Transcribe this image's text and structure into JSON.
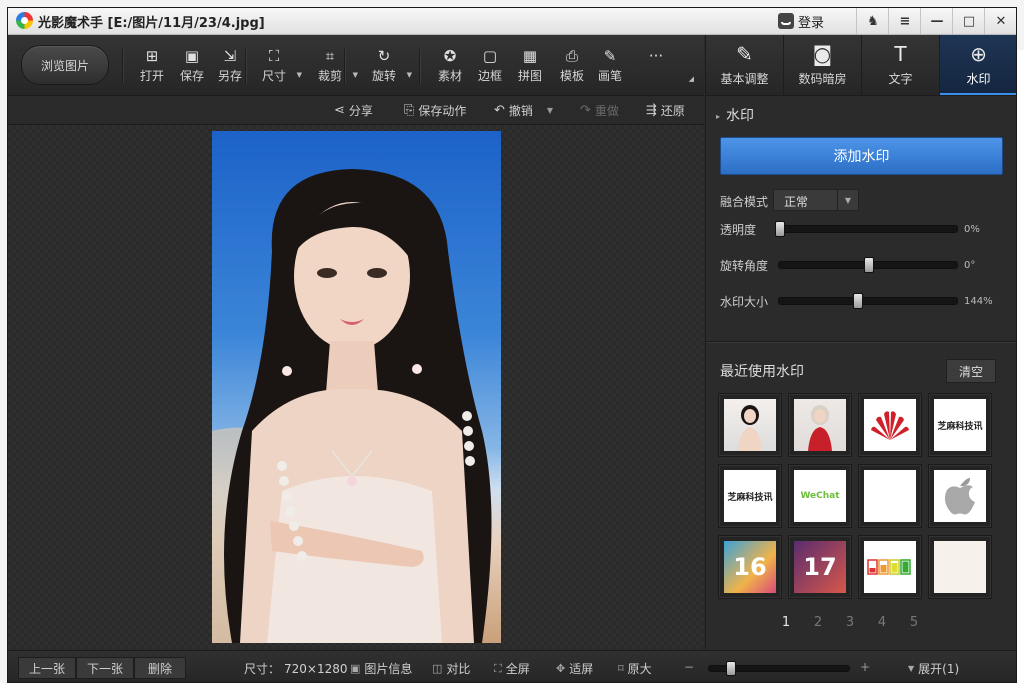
{
  "window": {
    "title": "光影魔术手 [E:/图片/11月/23/4.jpg]",
    "login": "登录"
  },
  "toolbar": {
    "browse": "浏览图片",
    "tools": [
      {
        "label": "打开",
        "icon": "open-icon",
        "glyph": "⊞"
      },
      {
        "label": "保存",
        "icon": "save-icon",
        "glyph": "▣"
      },
      {
        "label": "另存",
        "icon": "save-as-icon",
        "glyph": "⇲"
      },
      {
        "label": "尺寸",
        "icon": "resize-icon",
        "glyph": "⛶"
      },
      {
        "label": "裁剪",
        "icon": "crop-icon",
        "glyph": "⌗"
      },
      {
        "label": "旋转",
        "icon": "rotate-icon",
        "glyph": "↻"
      },
      {
        "label": "素材",
        "icon": "material-icon",
        "glyph": "✪"
      },
      {
        "label": "边框",
        "icon": "border-icon",
        "glyph": "▢"
      },
      {
        "label": "拼图",
        "icon": "collage-icon",
        "glyph": "▦"
      },
      {
        "label": "模板",
        "icon": "template-icon",
        "glyph": "⎙"
      },
      {
        "label": "画笔",
        "icon": "brush-icon",
        "glyph": "✎"
      },
      {
        "label": "",
        "icon": "more-icon",
        "glyph": "···"
      }
    ]
  },
  "subbar": {
    "share": "分享",
    "save_action": "保存动作",
    "undo": "撤销",
    "redo": "重做",
    "restore": "还原"
  },
  "right": {
    "tabs": [
      {
        "label": "基本调整",
        "icon": "adjust-icon",
        "glyph": "✎"
      },
      {
        "label": "数码暗房",
        "icon": "darkroom-icon",
        "glyph": "◙"
      },
      {
        "label": "文字",
        "icon": "text-icon",
        "glyph": "T"
      },
      {
        "label": "水印",
        "icon": "watermark-icon",
        "glyph": "⊕"
      }
    ],
    "section_title": "水印",
    "add_button": "添加水印",
    "blend_label": "融合模式",
    "blend_value": "正常",
    "opacity_label": "透明度",
    "opacity_value": "0%",
    "opacity_level": 0.0,
    "rotation_label": "旋转角度",
    "rotation_value": "0°",
    "rotation_level": 0.5,
    "size_label": "水印大小",
    "size_value": "144%",
    "size_level": 0.44,
    "recent_title": "最近使用水印",
    "clear_button": "清空",
    "thumbs": [
      {
        "name": "watermark-portrait-1",
        "text": ""
      },
      {
        "name": "watermark-portrait-2",
        "text": ""
      },
      {
        "name": "watermark-huawei-logo",
        "text": ""
      },
      {
        "name": "watermark-text-logo-1",
        "text": "芝麻科技讯"
      },
      {
        "name": "watermark-text-logo-2",
        "text": "芝麻科技讯"
      },
      {
        "name": "watermark-wechat-logo",
        "text": "WeChat"
      },
      {
        "name": "watermark-blank",
        "text": ""
      },
      {
        "name": "watermark-apple-logo",
        "text": ""
      },
      {
        "name": "watermark-ios16",
        "text": "16"
      },
      {
        "name": "watermark-ios17",
        "text": "17"
      },
      {
        "name": "watermark-battery",
        "text": ""
      },
      {
        "name": "watermark-light",
        "text": ""
      }
    ],
    "pages": [
      "1",
      "2",
      "3",
      "4",
      "5"
    ],
    "active_page": "1"
  },
  "status": {
    "prev": "上一张",
    "next": "下一张",
    "delete": "删除",
    "size_label": "尺寸：",
    "size_value": "720×1280",
    "info": "图片信息",
    "compare": "对比",
    "fullscreen": "全屏",
    "fit": "适屏",
    "original": "原大",
    "zoom_minus": "−",
    "zoom_plus": "+",
    "zoom_level": 0.15,
    "expand": "展开(1)"
  }
}
